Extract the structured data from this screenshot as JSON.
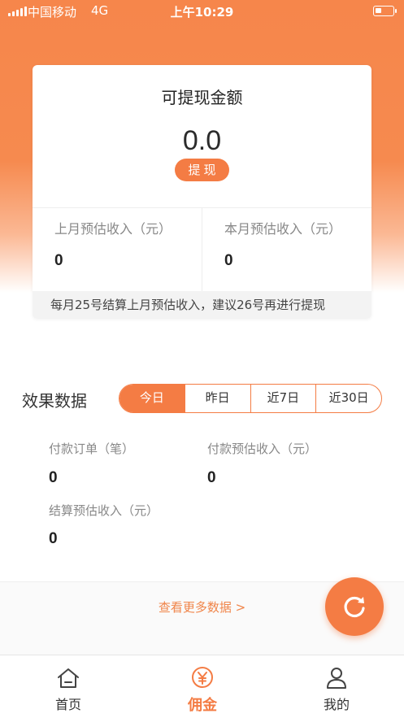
{
  "status_bar": {
    "carrier": "中国移动",
    "network": "4G",
    "time": "上午10:29"
  },
  "balance_card": {
    "title": "可提现金额",
    "amount": "0.0",
    "withdraw_label": "提现",
    "last_month_label": "上月预估收入（元）",
    "last_month_value": "0",
    "this_month_label": "本月预估收入（元）",
    "this_month_value": "0",
    "note": "每月25号结算上月预估收入，建议26号再进行提现"
  },
  "effect": {
    "title": "效果数据",
    "ranges": [
      "今日",
      "昨日",
      "近7日",
      "近30日"
    ],
    "active_range": "今日",
    "paid_orders_label": "付款订单（笔）",
    "paid_orders_value": "0",
    "paid_income_label": "付款预估收入（元）",
    "paid_income_value": "0",
    "settled_income_label": "结算预估收入（元）",
    "settled_income_value": "0"
  },
  "more": {
    "link_label": "查看更多数据 >"
  },
  "tabbar": {
    "items": [
      {
        "label": "首页",
        "icon": "home-icon"
      },
      {
        "label": "佣金",
        "icon": "yen-icon"
      },
      {
        "label": "我的",
        "icon": "user-icon"
      }
    ],
    "active": "佣金"
  },
  "colors": {
    "accent": "#f47c44",
    "header_bg": "#f6864b"
  }
}
